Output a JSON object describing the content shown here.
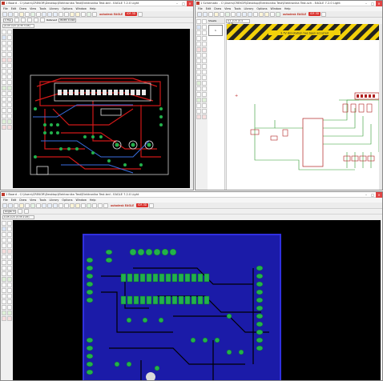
{
  "board_window_top": {
    "title": "1 Board - C:\\Users\\CREKOR\\Desktop\\Elektronika Test\\Elektronika Test.brd - EAGLE 7.2.0 Light",
    "menu": [
      "File",
      "Edit",
      "Draw",
      "View",
      "Tools",
      "Library",
      "Options",
      "Window",
      "Help"
    ],
    "logo": "autodesk EAGLE",
    "badge": "IDF-3D",
    "layer_select": "1 Top",
    "ratsnest_label": "Ratsnest",
    "width_label": "Width 0.016",
    "coord": "(0.05 inch (4.35 3.45)"
  },
  "schematic_window": {
    "title": "1 Schematic - C:\\Users\\CREKOR\\Desktop\\Elektronika Test\\Elektronika Test.sch - EAGLE 7.2.0 Light",
    "menu": [
      "File",
      "Edit",
      "Draw",
      "View",
      "Tools",
      "Library",
      "Options",
      "Window",
      "Help"
    ],
    "logo": "autodesk EAGLE",
    "badge": "IDF-3D",
    "sheets_header": "Sheets",
    "sheet_item": "1",
    "coord": "0.1 inch (0.4 -0.3)",
    "banner": "3.7V Annotation has been occurred"
  },
  "board_window_bottom": {
    "title": "1 Board - C:\\Users\\CREKOR\\Desktop\\Elektronika Test\\Elektronika Test.brd - EAGLE 7.2.0 Light",
    "menu": [
      "File",
      "Edit",
      "Draw",
      "View",
      "Tools",
      "Library",
      "Options",
      "Window",
      "Help"
    ],
    "logo": "autodesk EAGLE",
    "badge": "IDF-3D",
    "angle_label": "Angle: 0",
    "coord": "0.05 inch (3.35 2.45)"
  },
  "colors": {
    "pcb_board_top": "#2b2bd0",
    "pcb_board_bottom": "#1b1ba8",
    "trace_red": "#d01818",
    "pad_green": "#22b14c",
    "schematic_wire": "#2e9a2e",
    "schematic_part": "#b02020",
    "banner_stripe": "#f3d10a"
  }
}
